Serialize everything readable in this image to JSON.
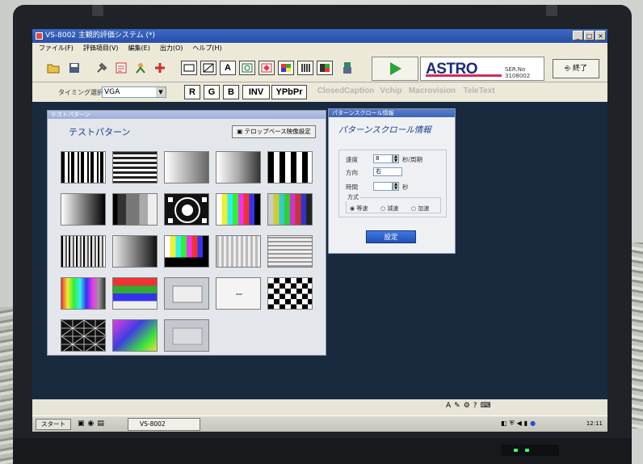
{
  "window": {
    "title": "VS-8002 主観的評価システム (*)",
    "buttons": [
      "_",
      "□",
      "×"
    ]
  },
  "menu": [
    "ファイル(F)",
    "評価項目(V)",
    "編集(E)",
    "出力(O)",
    "ヘルプ(H)"
  ],
  "toolbar": {
    "icons": [
      "folder-icon",
      "save-icon",
      "tool-icon",
      "list-icon",
      "person-icon",
      "add-icon",
      "rect-pattern-icon",
      "gradient-pattern-icon",
      "letter-pattern-icon",
      "circle-pattern-icon",
      "diamond-pattern-icon",
      "colorbar-pattern-icon",
      "grid-pattern-icon",
      "mixed-pattern-icon",
      "figure-icon"
    ],
    "letter_icon": "A",
    "brand": "ASTRO",
    "serial": "SER.No 3108002",
    "exit": "終了"
  },
  "timing": {
    "label": "タイミング選択",
    "value": "VGA",
    "signal_buttons": [
      "R",
      "G",
      "B",
      "INV",
      "YPbPr"
    ],
    "disabled_buttons": [
      "ClosedCaption",
      "Vchip",
      "Macrovision",
      "TeleText"
    ]
  },
  "test_pattern": {
    "header": "テストパターン",
    "title": "テストパターン",
    "telop_button": "テロップベース映像設定"
  },
  "pattern_scroll": {
    "header": "パターンスクロール情報",
    "title": "パターンスクロール情報",
    "speed_label": "速度",
    "speed_value": "8",
    "speed_unit": "秒/周期",
    "direction_label": "方向",
    "direction_value": "右",
    "time_label": "時間",
    "time_value": "",
    "time_unit": "秒",
    "method_label": "方式",
    "methods": [
      "等速",
      "減速",
      "加速"
    ],
    "set_button": "設定"
  },
  "taskbar": {
    "start": "スタート",
    "task": "VS-8002",
    "clock": "12:11"
  }
}
